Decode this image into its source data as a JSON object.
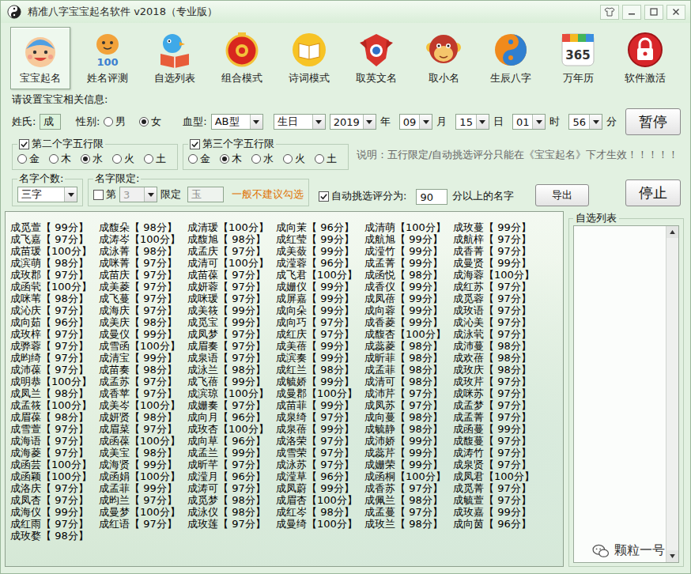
{
  "window": {
    "title": "精准八字宝宝起名软件 v2018（专业版）"
  },
  "toolbar": [
    {
      "label": "宝宝起名",
      "selected": true,
      "kind": "name"
    },
    {
      "label": "姓名评测",
      "selected": false,
      "kind": "review",
      "badge": "100"
    },
    {
      "label": "自选列表",
      "selected": false,
      "kind": "list"
    },
    {
      "label": "组合模式",
      "selected": false,
      "kind": "combo"
    },
    {
      "label": "诗词模式",
      "selected": false,
      "kind": "poem"
    },
    {
      "label": "取英文名",
      "selected": false,
      "kind": "english"
    },
    {
      "label": "取小名",
      "selected": false,
      "kind": "nickname"
    },
    {
      "label": "生辰八字",
      "selected": false,
      "kind": "bazi"
    },
    {
      "label": "万年历",
      "selected": false,
      "kind": "calendar",
      "badge": "365"
    },
    {
      "label": "软件激活",
      "selected": false,
      "kind": "activate"
    }
  ],
  "form": {
    "heading": "请设置宝宝相关信息:",
    "surname": {
      "label": "姓氏:",
      "value": "成"
    },
    "gender": {
      "label": "性别:",
      "options": [
        {
          "label": "男",
          "selected": false
        },
        {
          "label": "女",
          "selected": true
        }
      ]
    },
    "blood": {
      "label": "血型:",
      "value": "AB型"
    },
    "date_mode": {
      "value": "生日"
    },
    "date": [
      {
        "value": "2019",
        "unit": "年"
      },
      {
        "value": "09",
        "unit": "月"
      },
      {
        "value": "15",
        "unit": "日"
      },
      {
        "value": "01",
        "unit": "时"
      },
      {
        "value": "56",
        "unit": "分"
      }
    ],
    "pause_button": "暂停",
    "element_groups": [
      {
        "label": "第二个字五行限",
        "checked": true,
        "options": [
          {
            "label": "金",
            "selected": false
          },
          {
            "label": "木",
            "selected": false
          },
          {
            "label": "水",
            "selected": true
          },
          {
            "label": "火",
            "selected": false
          },
          {
            "label": "土",
            "selected": false
          }
        ]
      },
      {
        "label": "第三个字五行限",
        "checked": true,
        "options": [
          {
            "label": "金",
            "selected": false
          },
          {
            "label": "木",
            "selected": true
          },
          {
            "label": "水",
            "selected": false
          },
          {
            "label": "火",
            "selected": false
          },
          {
            "label": "土",
            "selected": false
          }
        ]
      }
    ],
    "note": "说明：五行限定/自动挑选评分只能在《宝宝起名》下才生效！！！！！",
    "name_count": {
      "label": "名字个数:",
      "value": "三字"
    },
    "name_limit": {
      "label": "名字限定:",
      "checked": false,
      "disabled": true,
      "prefix": "第",
      "position": "3",
      "suffix": "限定",
      "char": "玉",
      "hint": "一般不建议勾选"
    },
    "auto_score": {
      "label": "自动挑选评分为:",
      "checked": true,
      "value": "90",
      "suffix": "分以上的名字"
    },
    "export_button": "导出",
    "stop_button": "停止"
  },
  "results": {
    "names": [
      "成觅萱【 99分】",
      "成馥朵【 98分】",
      "成清瑗【100分】",
      "成向茉【 96分】",
      "成清萌【100分】",
      "成玫蔓【 99分】",
      "成飞嘉【 97分】",
      "成涛岑【100分】",
      "成馥旭【 98分】",
      "成红莹【 99分】",
      "成航旭【 99分】",
      "成航梓【 97分】",
      "成苗瑗【100分】",
      "成泳菁【 98分】",
      "成孟庆【 97分】",
      "成美蔹【 99分】",
      "成滢竹【 99分】",
      "成香菁【 97分】",
      "成滨萌【 98分】",
      "成咪菁【 97分】",
      "成清可【100分】",
      "成滢蓉【 96分】",
      "成孟菁【 99分】",
      "成曼贤【 99分】",
      "成玫郡【 97分】",
      "成苗庆【 97分】",
      "成苗葆【 97分】",
      "成飞君【100分】",
      "成函悦【 98分】",
      "成海蓉【100分】",
      "成函茕【100分】",
      "成美菱【 97分】",
      "成妍蓉【 97分】",
      "成姗仪【 99分】",
      "成香仪【 99分】",
      "成红苏【 97分】",
      "成咪苇【 98分】",
      "成飞蔓【 97分】",
      "成咪瑗【 97分】",
      "成屏嘉【 99分】",
      "成凤蓓【 99分】",
      "成觅蓉【 97分】",
      "成沁庆【 97分】",
      "成海庆【 97分】",
      "成美筱【 99分】",
      "成向朵【 99分】",
      "成向蓉【 99分】",
      "成玫语【 97分】",
      "成向茹【 96分】",
      "成美庆【 98分】",
      "成觅宝【 99分】",
      "成向巧【 97分】",
      "成香菱【 99分】",
      "成沁美【 97分】",
      "成玫梓【 97分】",
      "成曼仪【 99分】",
      "成凤梦【 97分】",
      "成红庆【 97分】",
      "成馥杏【100分】",
      "成泳茕【 97分】",
      "成骅蓉【 97分】",
      "成雪函【100分】",
      "成眉奏【 97分】",
      "成美蓓【 99分】",
      "成蕊菱【 98分】",
      "成沛蔓【 98分】",
      "成昀绮【 97分】",
      "成清宝【 99分】",
      "成泉语【 97分】",
      "成滨奏【 99分】",
      "成昕菲【 98分】",
      "成欢蓓【 98分】",
      "成沛葆【 97分】",
      "成苗奏【 98分】",
      "成泳兰【 98分】",
      "成红兰【 98分】",
      "成孟菲【 98分】",
      "成玫庆【 98分】",
      "成明恭【100分】",
      "成孟苏【 97分】",
      "成飞蓓【 99分】",
      "成毓娇【 99分】",
      "成清可【 98分】",
      "成玫芹【 97分】",
      "成凤兰【 98分】",
      "成香苹【 97分】",
      "成滨琼【100分】",
      "成曼郡【100分】",
      "成沛芹【 97分】",
      "成咪苏【 97分】",
      "成孟筱【100分】",
      "成美岑【100分】",
      "成姗奏【 97分】",
      "成苗菲【 99分】",
      "成凤苏【 97分】",
      "成孟梦【 97分】",
      "成眉葆【 98分】",
      "成妍贤【 98分】",
      "成向月【 96分】",
      "成泉绮【 97分】",
      "成向蔓【 98分】",
      "成孟菁【 97分】",
      "成雪萱【 97分】",
      "成眉菜【 97分】",
      "成玫杏【100分】",
      "成泉蓓【 99分】",
      "成毓静【 98分】",
      "成函蔓【 99分】",
      "成海语【 97分】",
      "成函葆【100分】",
      "成向草【 96分】",
      "成洛荣【 97分】",
      "成沛娇【 99分】",
      "成馥蔓【 97分】",
      "成海菱【 97分】",
      "成美宝【 98分】",
      "成孟兰【 99分】",
      "成雪荣【 97分】",
      "成蕊芹【 99分】",
      "成涛竹【 97分】",
      "成函芸【100分】",
      "成海贤【 99分】",
      "成昕芊【 97分】",
      "成泳苏【 97分】",
      "成姗荣【 99分】",
      "成泉贤【 97分】",
      "成函颖【100分】",
      "成函娟【100分】",
      "成滢月【 96分】",
      "成滢草【 96分】",
      "成函桐【100分】",
      "成凤君【100分】",
      "成洛庆【 97分】",
      "成孟菲【 99分】",
      "成涛可【 97分】",
      "成凤蔚【 99分】",
      "成香苏【 97分】",
      "成觅菁【 97分】",
      "成凤杏【 97分】",
      "成昀兰【 97分】",
      "成觅梦【 98分】",
      "成眉杏【100分】",
      "成佩兰【 98分】",
      "成毓萱【 97分】",
      "成海仪【 99分】",
      "成曼梦【100分】",
      "成泳仪【 98分】",
      "成红岑【 98分】",
      "成孟蔓【 97分】",
      "成玫嘉【 99分】",
      "成红雨【 97分】",
      "成红语【 97分】",
      "成玫莲【 97分】",
      "成曼绮【100分】",
      "成玫兰【 98分】",
      "成向茵【 96分】",
      "成玫婺【 98分】"
    ]
  },
  "favorites": {
    "title": "自选列表"
  },
  "watermark": "颗粒一号"
}
